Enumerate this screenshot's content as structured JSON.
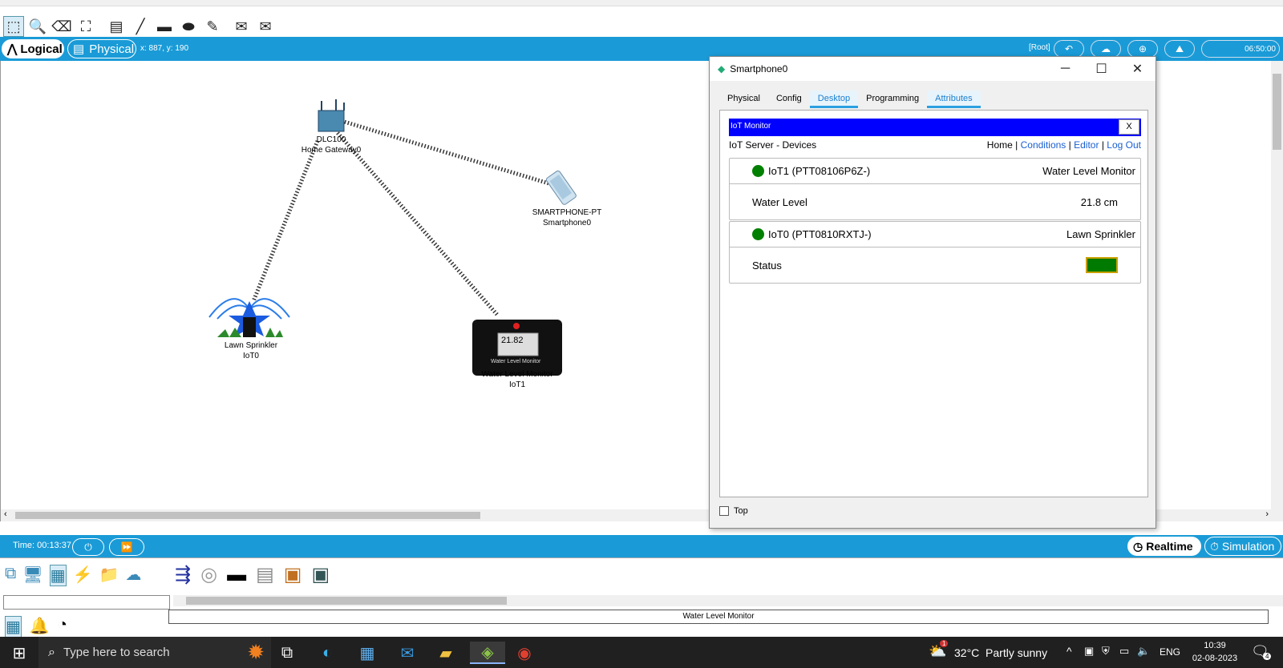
{
  "toolbar": {
    "icons": [
      "select-icon",
      "inspect-icon",
      "delete-icon",
      "resize-icon",
      "note-icon",
      "line-icon",
      "rectangle-icon",
      "ellipse-icon",
      "freeform-icon",
      "pdu-simple-icon",
      "pdu-complex-icon"
    ]
  },
  "mode_bar": {
    "logical_label": "Logical",
    "physical_label": "Physical",
    "coords": "x: 887, y: 190",
    "root_label": "[Root]",
    "clock": "06:50:00"
  },
  "devices": {
    "gateway": {
      "model": "DLC100",
      "name": "Home Gateway0"
    },
    "smartphone": {
      "model": "SMARTPHONE-PT",
      "name": "Smartphone0"
    },
    "sprinkler": {
      "model": "Lawn Sprinkler",
      "name": "IoT0"
    },
    "monitor": {
      "model": "Water Level Monitor",
      "name": "IoT1",
      "display_value": "21.82",
      "display_caption": "Water Level Monitor"
    }
  },
  "popup": {
    "title": "Smartphone0",
    "tabs": [
      "Physical",
      "Config",
      "Desktop",
      "Programming",
      "Attributes"
    ],
    "active_tab": "Desktop",
    "app_title": "IoT Monitor",
    "close_label": "X",
    "server_label": "IoT Server - Devices",
    "nav": {
      "home": "Home",
      "conditions": "Conditions",
      "editor": "Editor",
      "logout": "Log Out",
      "sep": "|"
    },
    "cards": [
      {
        "id": "IoT1 (PTT08106P6Z-)",
        "type": "Water Level Monitor",
        "field": "Water Level",
        "value": "21.8 cm"
      },
      {
        "id": "IoT0 (PTT0810RXTJ-)",
        "type": "Lawn Sprinkler",
        "field": "Status",
        "value": "",
        "status_color": "#008000"
      }
    ],
    "top_checkbox_label": "Top"
  },
  "time_bar": {
    "time": "Time: 00:13:37",
    "realtime_label": "Realtime",
    "simulation_label": "Simulation"
  },
  "device_panel": {
    "selected_caption": "Water Level Monitor"
  },
  "taskbar": {
    "search_placeholder": "Type here to search",
    "weather": "32°C  Partly sunny",
    "weather_badge": "1",
    "lang": "ENG",
    "time": "10:39",
    "date": "02-08-2023",
    "notif_count": "4"
  }
}
